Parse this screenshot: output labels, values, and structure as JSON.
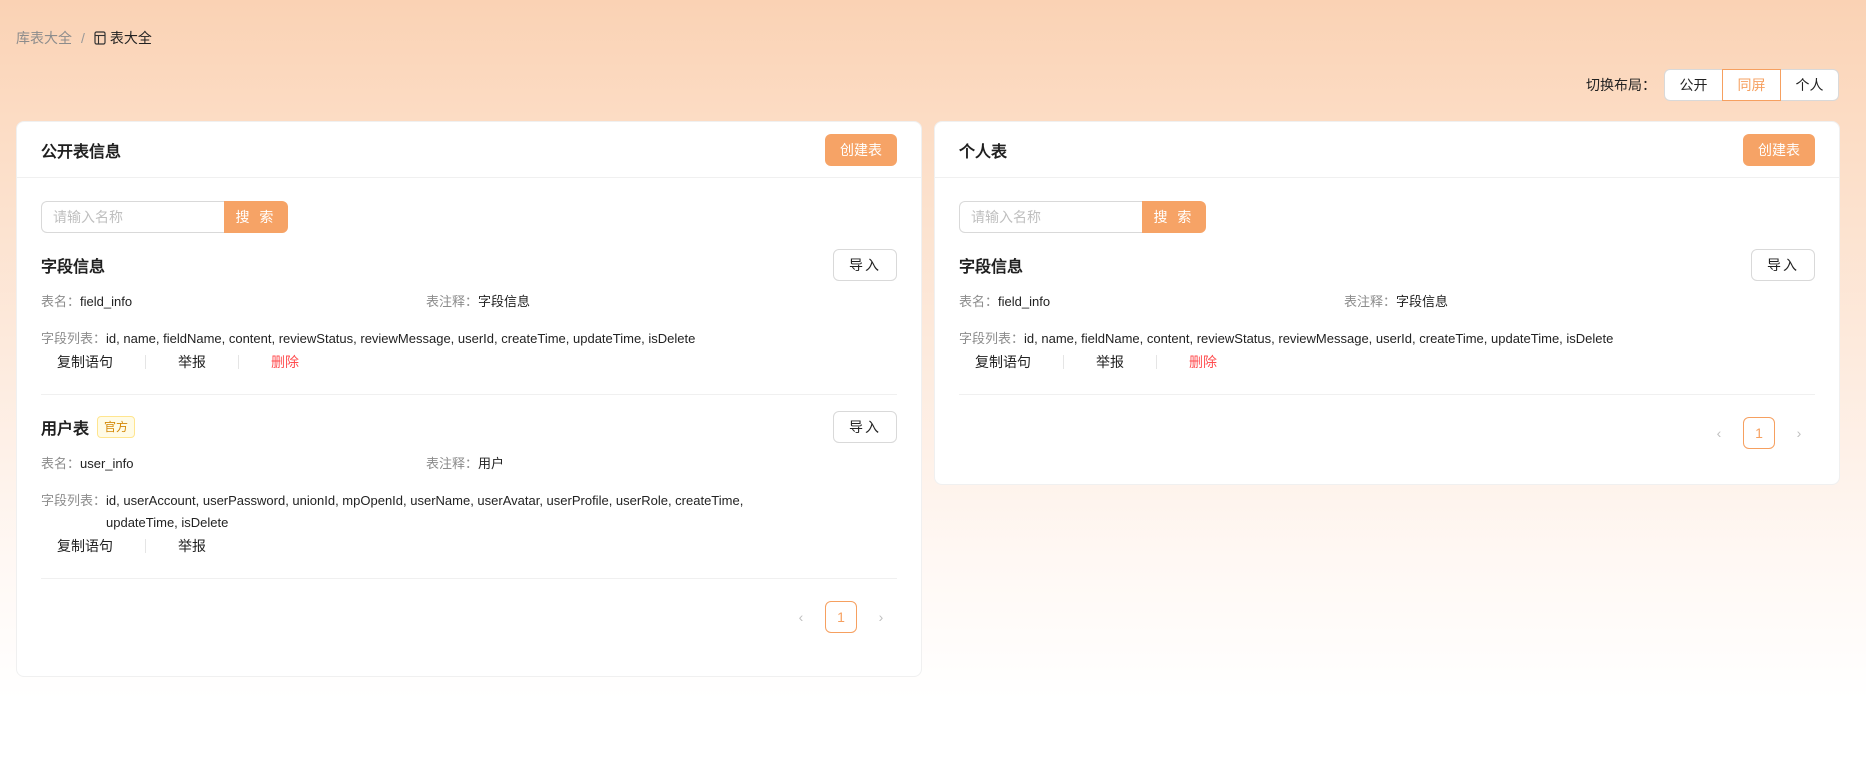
{
  "breadcrumb": {
    "parent": "库表大全",
    "separator": "/",
    "current": "表大全"
  },
  "layout_switch": {
    "label": "切换布局：",
    "options": [
      "公开",
      "同屏",
      "个人"
    ],
    "selected": "同屏"
  },
  "public_card": {
    "title": "公开表信息",
    "create_label": "创建表",
    "search_placeholder": "请输入名称",
    "search_label": "搜 索",
    "items": [
      {
        "title": "字段信息",
        "tag": "",
        "import_label": "导入",
        "table_name_key": "表名：",
        "table_name": "field_info",
        "comment_key": "表注释：",
        "comment": "字段信息",
        "fields_key": "字段列表：",
        "fields": "id, name, fieldName, content, reviewStatus, reviewMessage, userId, createTime, updateTime, isDelete",
        "copy_label": "复制语句",
        "report_label": "举报",
        "delete_label": "删除"
      },
      {
        "title": "用户表",
        "tag": "官方",
        "import_label": "导入",
        "table_name_key": "表名：",
        "table_name": "user_info",
        "comment_key": "表注释：",
        "comment": "用户",
        "fields_key": "字段列表：",
        "fields": "id, userAccount, userPassword, unionId, mpOpenId, userName, userAvatar, userProfile, userRole, createTime, updateTime, isDelete",
        "copy_label": "复制语句",
        "report_label": "举报"
      }
    ],
    "page": "1"
  },
  "personal_card": {
    "title": "个人表",
    "create_label": "创建表",
    "search_placeholder": "请输入名称",
    "search_label": "搜 索",
    "items": [
      {
        "title": "字段信息",
        "import_label": "导入",
        "table_name_key": "表名：",
        "table_name": "field_info",
        "comment_key": "表注释：",
        "comment": "字段信息",
        "fields_key": "字段列表：",
        "fields": "id, name, fieldName, content, reviewStatus, reviewMessage, userId, createTime, updateTime, isDelete",
        "copy_label": "复制语句",
        "report_label": "举报",
        "delete_label": "删除"
      }
    ],
    "page": "1"
  },
  "colors": {
    "accent": "#f6a366",
    "danger": "#ff4d4f",
    "tag_text": "#d48806"
  }
}
